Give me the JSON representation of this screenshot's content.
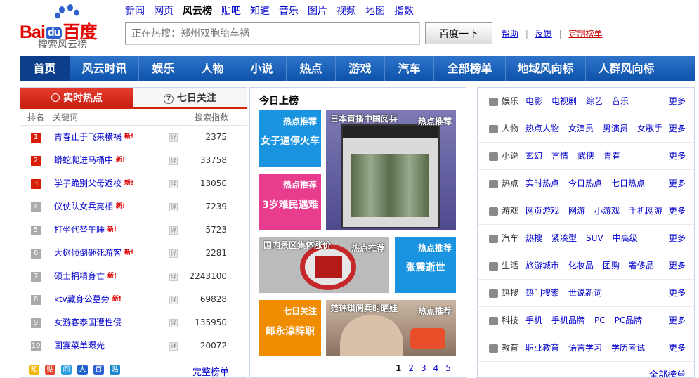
{
  "logo": {
    "text_left": "Bai",
    "text_du": "du",
    "text_right": "百度",
    "subtitle": "搜索风云榜"
  },
  "topnav": [
    "新闻",
    "网页",
    "风云榜",
    "贴吧",
    "知道",
    "音乐",
    "图片",
    "视频",
    "地图",
    "指数"
  ],
  "topnav_current": "风云榜",
  "search": {
    "placeholder": "正在热搜：郑州双胞胎车祸",
    "button": "百度一下"
  },
  "toplinks": {
    "help": "帮助",
    "sep": "|",
    "feedback": "反馈",
    "custom": "定制榜单"
  },
  "mainnav": [
    "首页",
    "风云时讯",
    "娱乐",
    "人物",
    "小说",
    "热点",
    "游戏",
    "汽车",
    "全部榜单",
    "地域风向标",
    "人群风向标"
  ],
  "left": {
    "tabs": [
      "实时热点",
      "七日关注"
    ],
    "header": {
      "rank": "排名",
      "keyword": "关键词",
      "index": "搜索指数"
    },
    "rows": [
      {
        "rank": "1",
        "keyword": "青春止于飞来横祸",
        "new": "新!",
        "value": "2375"
      },
      {
        "rank": "2",
        "keyword": "蟒蛇爬进马桶中",
        "new": "新!",
        "value": "33758"
      },
      {
        "rank": "3",
        "keyword": "学子跪别父母返校",
        "new": "新!",
        "value": "13050"
      },
      {
        "rank": "4",
        "keyword": "仪仗队女兵亮相",
        "new": "新!",
        "value": "7239"
      },
      {
        "rank": "5",
        "keyword": "打坐代替午睡",
        "new": "新!",
        "value": "5723"
      },
      {
        "rank": "6",
        "keyword": "大树倾倒砸死游客",
        "new": "新!",
        "value": "2281"
      },
      {
        "rank": "7",
        "keyword": "硕士捐精身亡",
        "new": "新!",
        "value": "2243100"
      },
      {
        "rank": "8",
        "keyword": "ktv藏身公墓旁",
        "new": "新!",
        "value": "69828"
      },
      {
        "rank": "9",
        "keyword": "女游客泰国遭性侵",
        "new": "",
        "value": "135950"
      },
      {
        "rank": "10",
        "keyword": "国宴菜单曝光",
        "new": "",
        "value": "20072"
      }
    ],
    "detail_icon": "详",
    "footer_icons": [
      "知",
      "贴",
      "问",
      "人",
      "百",
      "贴"
    ],
    "full_list": "完整榜单"
  },
  "mid": {
    "title": "今日上榜",
    "tiles": [
      {
        "tag": "热点推荐",
        "text": "女子逼停火车",
        "color": "#1a94e0"
      },
      {
        "tag": "热点推荐",
        "text": "3岁难民遇难",
        "color": "#e83c8f"
      },
      {
        "tag": "热点推荐",
        "text": "日本直播中国阅兵"
      },
      {
        "tag": "热点推荐",
        "text": "国内景区集体涨价"
      },
      {
        "tag": "热点推荐",
        "text": "张震逝世",
        "color": "#1a94e0"
      },
      {
        "tag": "七日关注",
        "text": "郎永淳辞职",
        "color": "#f08c00"
      },
      {
        "tag": "热点推荐",
        "text": "范玮琪阅兵时晒娃"
      }
    ],
    "pages": [
      "1",
      "2",
      "3",
      "4",
      "5"
    ]
  },
  "right": {
    "rows": [
      {
        "label": "娱乐",
        "items": [
          "电影",
          "电视剧",
          "综艺",
          "音乐"
        ],
        "more": "更多",
        "icon": "microphone-icon"
      },
      {
        "label": "人物",
        "items": [
          "热点人物",
          "女演员",
          "男演员",
          "女歌手"
        ],
        "more": "更多",
        "icon": "person-icon"
      },
      {
        "label": "小说",
        "items": [
          "玄幻",
          "言情",
          "武侠",
          "青春"
        ],
        "more": "更多",
        "icon": "book-icon"
      },
      {
        "label": "热点",
        "items": [
          "实时热点",
          "今日热点",
          "七日热点"
        ],
        "more": "更多",
        "icon": "clock-icon"
      },
      {
        "label": "游戏",
        "items": [
          "网页游戏",
          "网游",
          "小游戏",
          "手机网游"
        ],
        "more": "更多",
        "icon": "gamepad-icon"
      },
      {
        "label": "汽车",
        "items": [
          "热搜",
          "紧凑型",
          "SUV",
          "中高级"
        ],
        "more": "更多",
        "icon": "car-icon"
      },
      {
        "label": "生活",
        "items": [
          "旅游城市",
          "化妆品",
          "团购",
          "奢侈品"
        ],
        "more": "更多",
        "icon": "cup-icon"
      },
      {
        "label": "热搜",
        "items": [
          "热门搜索",
          "世说新词"
        ],
        "more": "更多",
        "icon": "flame-icon"
      },
      {
        "label": "科技",
        "items": [
          "手机",
          "手机品牌",
          "PC",
          "PC品牌"
        ],
        "more": "更多",
        "icon": "monitor-icon"
      },
      {
        "label": "教育",
        "items": [
          "职业教育",
          "语言学习",
          "学历考试"
        ],
        "more": "更多",
        "icon": "graduation-icon"
      }
    ],
    "full_list": "全部榜单"
  }
}
